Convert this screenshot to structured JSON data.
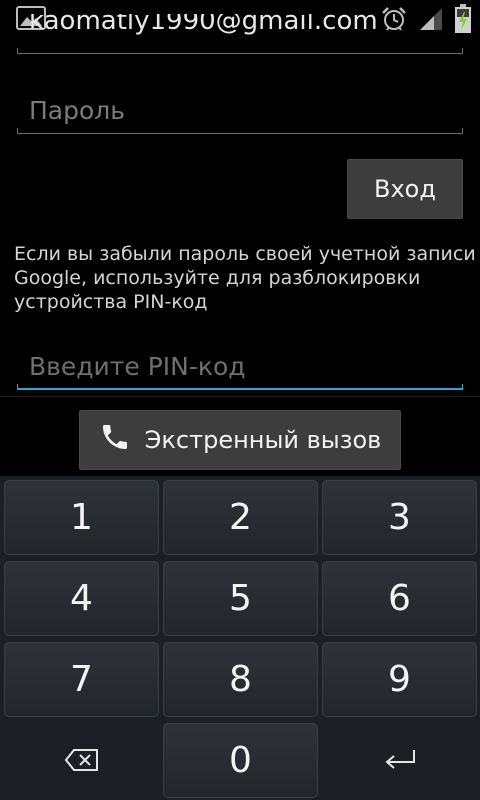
{
  "status_bar": {
    "icons": [
      "gallery-notification-icon",
      "alarm-icon",
      "signal-icon",
      "battery-charging-icon"
    ]
  },
  "form": {
    "account_value": "kaomatly1990@gmail.com",
    "password_placeholder": "Пароль",
    "login_label": "Вход",
    "hint_text": "Если вы забыли пароль своей учетной записи Google, используйте для разблокировки устройства PIN-код",
    "pin_placeholder": "Введите PIN-код"
  },
  "emergency": {
    "label": "Экстренный вызов",
    "icon": "phone-icon"
  },
  "keypad": {
    "keys": [
      "1",
      "2",
      "3",
      "4",
      "5",
      "6",
      "7",
      "8",
      "9",
      "0"
    ],
    "backspace_icon": "backspace-icon",
    "enter_icon": "enter-icon"
  },
  "colors": {
    "accent": "#2ea3d9",
    "background": "#000000",
    "keypad_bg": "#1c2025",
    "button_bg": "#3d3d3d"
  }
}
